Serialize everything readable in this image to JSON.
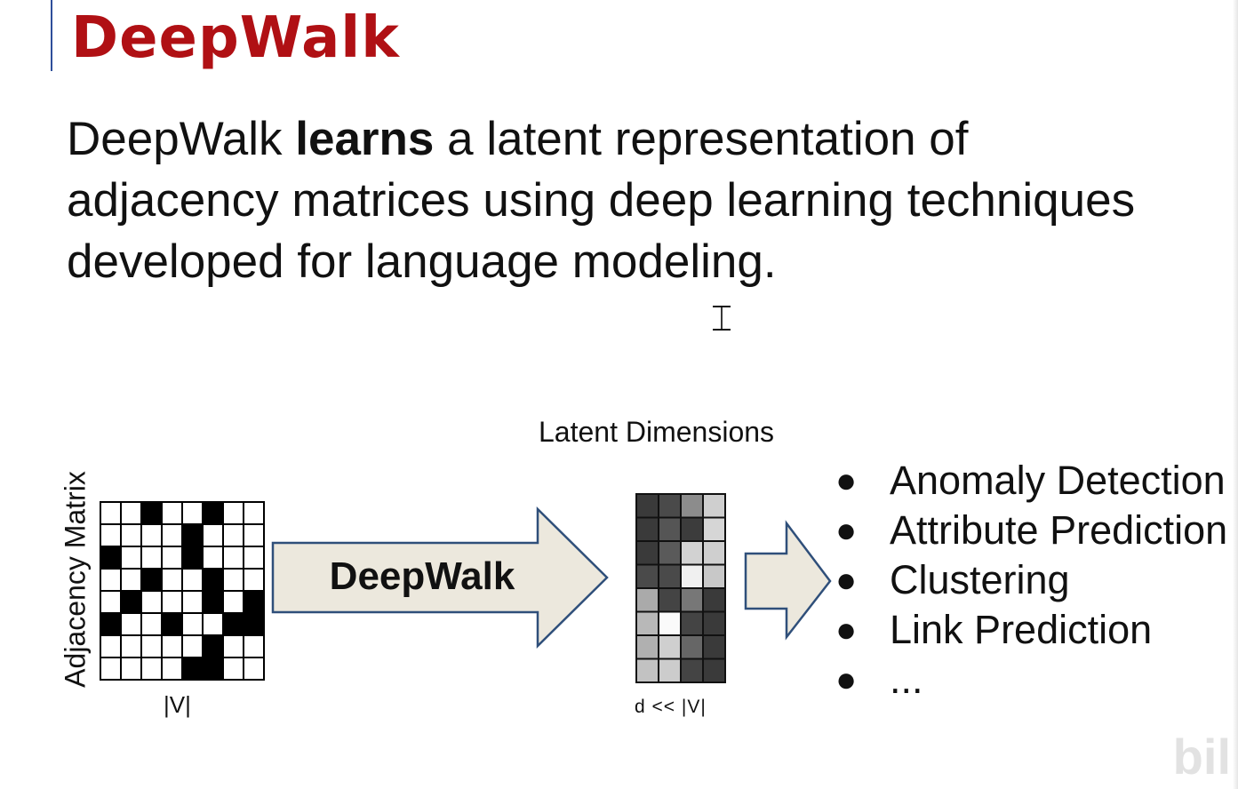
{
  "slide": {
    "title": "DeepWalk",
    "body": {
      "part1": "DeepWalk ",
      "bold": "learns",
      "part2": " a latent representation of adjacency matrices using deep learning techniques developed for language modeling."
    }
  },
  "diagram": {
    "adjacency_label": "Adjacency Matrix",
    "adjacency_bottom_label": "|V|",
    "arrow_label": "DeepWalk",
    "latent_title": "Latent Dimensions",
    "latent_bottom_label": "d  <<  |V|",
    "adjacency_cells": [
      [
        0,
        0,
        1,
        0,
        0,
        1,
        0,
        0
      ],
      [
        0,
        0,
        0,
        0,
        1,
        0,
        0,
        0
      ],
      [
        1,
        0,
        0,
        0,
        1,
        0,
        0,
        0
      ],
      [
        0,
        0,
        1,
        0,
        0,
        1,
        0,
        0
      ],
      [
        0,
        1,
        0,
        0,
        0,
        1,
        0,
        1
      ],
      [
        1,
        0,
        0,
        1,
        0,
        0,
        1,
        1
      ],
      [
        0,
        0,
        0,
        0,
        0,
        1,
        0,
        0
      ],
      [
        0,
        0,
        0,
        0,
        1,
        1,
        0,
        0
      ]
    ],
    "latent_shades": [
      [
        "#3a3a3a",
        "#4a4a4a",
        "#8c8c8c",
        "#cfcfcf"
      ],
      [
        "#3a3a3a",
        "#555555",
        "#3c3c3c",
        "#d6d6d6"
      ],
      [
        "#3a3a3a",
        "#5a5a5a",
        "#d2d2d2",
        "#cfcfcf"
      ],
      [
        "#4a4a4a",
        "#4a4a4a",
        "#f0f0f0",
        "#c8c8c8"
      ],
      [
        "#aaaaaa",
        "#444444",
        "#777777",
        "#3a3a3a"
      ],
      [
        "#b8b8b8",
        "#fafafa",
        "#444444",
        "#3a3a3a"
      ],
      [
        "#b0b0b0",
        "#cfcfcf",
        "#666666",
        "#3a3a3a"
      ],
      [
        "#c2c2c2",
        "#cccccc",
        "#444444",
        "#3a3a3a"
      ]
    ],
    "arrow_fill": "#ece8dd",
    "arrow_stroke": "#2f4f7a"
  },
  "applications": {
    "bullet": "●",
    "items": [
      "Anomaly Detection",
      "Attribute Prediction",
      "Clustering",
      "Link Prediction",
      "..."
    ]
  },
  "colors": {
    "title": "#b01014",
    "accent_bar": "#2f4f9a"
  }
}
